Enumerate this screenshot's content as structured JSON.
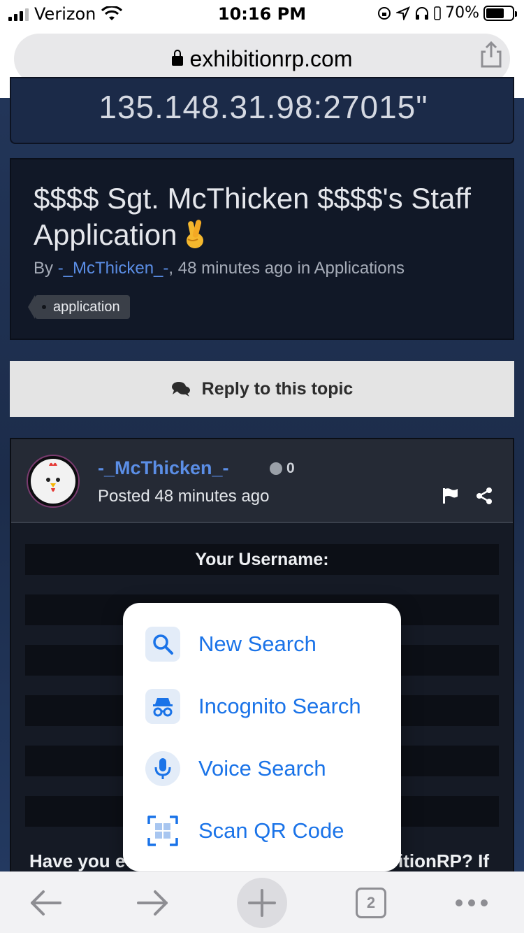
{
  "status_bar": {
    "carrier": "Verizon",
    "time": "10:16 PM",
    "battery": "70%",
    "battery_level": 0.7
  },
  "address_bar": {
    "url": "exhibitionrp.com"
  },
  "page": {
    "server_ip": "135.148.31.98:27015\"",
    "topic": {
      "title": "$$$$ Sgt. McThicken $$$$'s Staff Application",
      "by_label": "By",
      "author": "-_McThicken_-",
      "meta": ", 48 minutes ago in Applications",
      "tag": "application"
    },
    "reply_button": "Reply to this topic",
    "post": {
      "author": "-_McThicken_-",
      "reputation": "0",
      "posted": "Posted 48 minutes ago",
      "username_label": "Your Username:",
      "question_left": "Have you e",
      "question_right": "itionRP? If"
    }
  },
  "popup_menu": {
    "items": [
      {
        "label": "New Search",
        "icon": "search-icon"
      },
      {
        "label": "Incognito Search",
        "icon": "incognito-icon"
      },
      {
        "label": "Voice Search",
        "icon": "microphone-icon"
      },
      {
        "label": "Scan QR Code",
        "icon": "qr-scan-icon"
      }
    ]
  },
  "toolbar": {
    "tab_count": "2"
  },
  "colors": {
    "accent": "#1a73e8",
    "link": "#5b8ee6"
  }
}
